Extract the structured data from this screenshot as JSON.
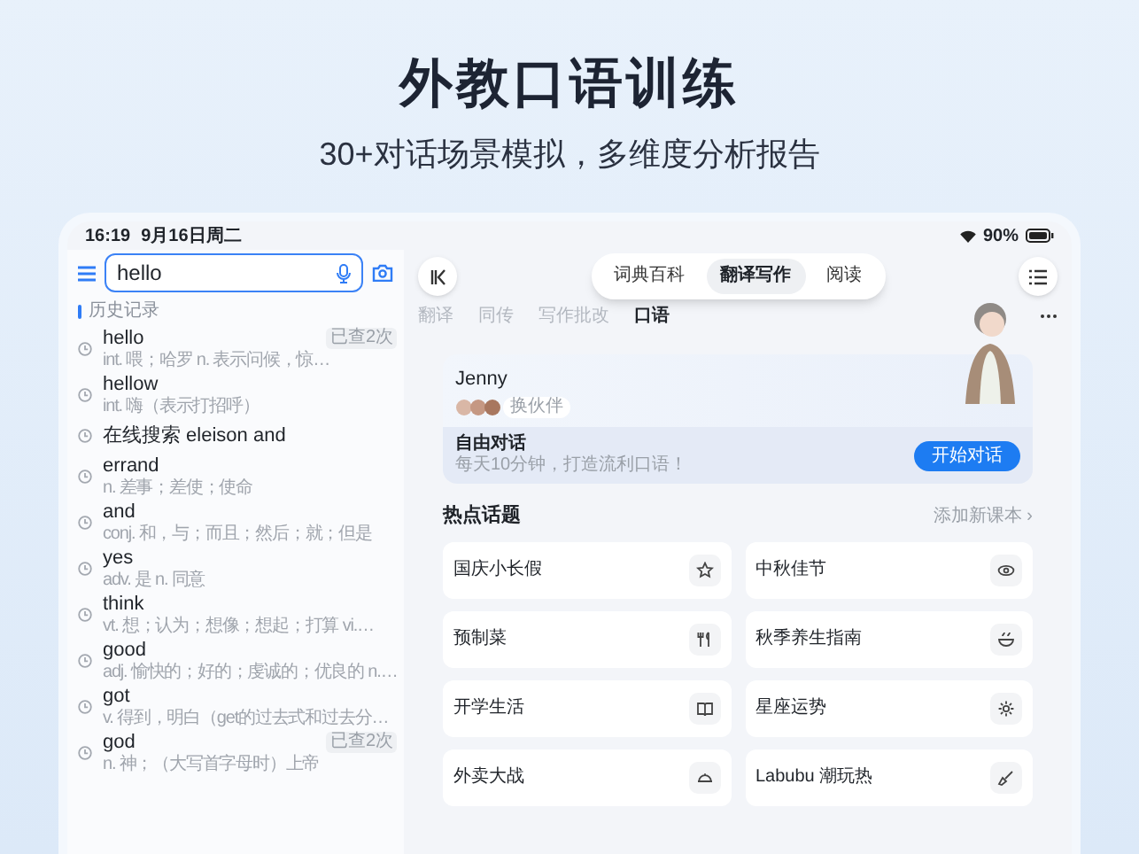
{
  "hero": {
    "title": "外教口语训练",
    "subtitle": "30+对话场景模拟，多维度分析报告"
  },
  "status_bar": {
    "time": "16:19",
    "date": "9月16日周二",
    "battery": "90%"
  },
  "sidebar": {
    "search": {
      "value": "hello"
    },
    "history_label": "历史记录",
    "history": [
      {
        "word": "hello",
        "meaning": "int. 喂；哈罗 n. 表示问候，惊…",
        "badge": "已查2次"
      },
      {
        "word": "hellow",
        "meaning": "int. 嗨（表示打招呼）"
      },
      {
        "word": "在线搜索 eleison and"
      },
      {
        "word": "errand",
        "meaning": "n. 差事；差使；使命"
      },
      {
        "word": "and",
        "meaning": "conj. 和，与；而且；然后；就；但是"
      },
      {
        "word": "yes",
        "meaning": "adv. 是 n. 同意"
      },
      {
        "word": "think",
        "meaning": "vt. 想；认为；想像；想起；打算 vi.…"
      },
      {
        "word": "good",
        "meaning": "adj. 愉快的；好的；虔诚的；优良的 n.…"
      },
      {
        "word": "got",
        "meaning": "v. 得到，明白（get的过去式和过去分…"
      },
      {
        "word": "god",
        "meaning": "n. 神；（大写首字母时）上帝",
        "badge": "已查2次"
      }
    ]
  },
  "top_tabs": [
    {
      "label": "词典百科",
      "selected": false
    },
    {
      "label": "翻译写作",
      "selected": true
    },
    {
      "label": "阅读",
      "selected": false
    }
  ],
  "sub_tabs": [
    {
      "label": "翻译",
      "selected": false
    },
    {
      "label": "同传",
      "selected": false
    },
    {
      "label": "写作批改",
      "selected": false
    },
    {
      "label": "口语",
      "selected": true
    }
  ],
  "partner_card": {
    "name": "Jenny",
    "action": "换伙伴",
    "mode_title": "自由对话",
    "mode_subtitle": "每天10分钟，打造流利口语！",
    "button": "开始对话"
  },
  "hot_topics": {
    "title": "热点话题",
    "link": "添加新课本 ›",
    "items": [
      {
        "label": "国庆小长假"
      },
      {
        "label": "中秋佳节"
      },
      {
        "label": "预制菜"
      },
      {
        "label": "秋季养生指南"
      },
      {
        "label": "开学生活"
      },
      {
        "label": "星座运势"
      },
      {
        "label": "外卖大战"
      },
      {
        "label": "Labubu 潮玩热"
      }
    ]
  }
}
